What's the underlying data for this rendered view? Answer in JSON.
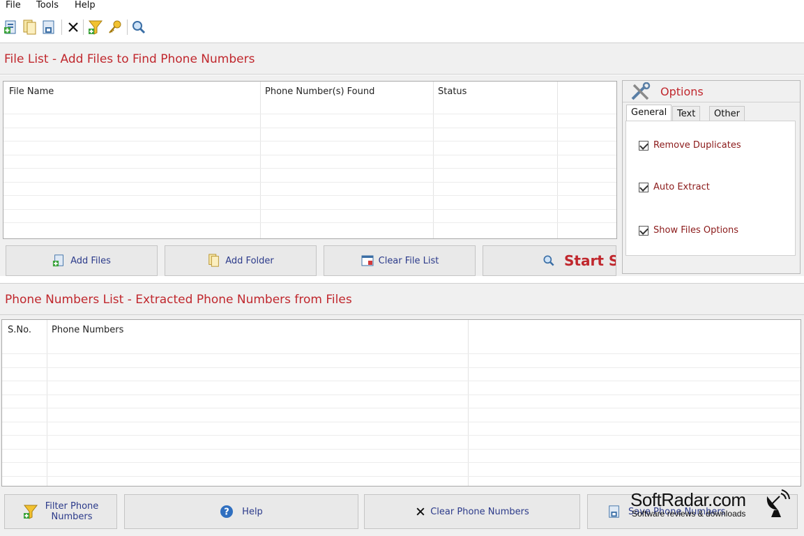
{
  "menu": {
    "file": "File",
    "tools": "Tools",
    "help": "Help"
  },
  "toolbar": {
    "icons": [
      "add-files-icon",
      "add-folder-icon",
      "save-icon",
      "clear-icon",
      "filter-icon",
      "key-icon",
      "search-icon"
    ]
  },
  "file_section": {
    "title": "File List - Add Files to Find Phone Numbers",
    "columns": [
      "File Name",
      "Phone Number(s) Found",
      "Status"
    ],
    "rows": []
  },
  "file_buttons": {
    "add_files": "Add Files",
    "add_folder": "Add Folder",
    "clear_file_list": "Clear File List",
    "start_search": "Start Se"
  },
  "options": {
    "title": "Options",
    "tabs": [
      "General",
      "Text",
      "Other"
    ],
    "active_tab": "General",
    "checkboxes": [
      {
        "label": "Remove Duplicates",
        "checked": true
      },
      {
        "label": "Auto Extract",
        "checked": true
      },
      {
        "label": "Show Files Options",
        "checked": true
      }
    ]
  },
  "phone_section": {
    "title": "Phone Numbers List - Extracted Phone Numbers from Files",
    "columns": [
      "S.No.",
      "Phone Numbers"
    ],
    "rows": []
  },
  "bottom_buttons": {
    "filter_line1": "Filter Phone",
    "filter_line2": "Numbers",
    "help": "Help",
    "clear_phone_numbers": "Clear Phone Numbers",
    "save_phone_numbers": "Save Phone Numbers"
  },
  "watermark": {
    "title": "SoftRadar.com",
    "subtitle": "Software reviews & downloads"
  },
  "colors": {
    "section_title": "#c0272d",
    "button_text": "#2b3a8a",
    "option_label": "#8b1a1a",
    "start_search": "#c0272d"
  }
}
